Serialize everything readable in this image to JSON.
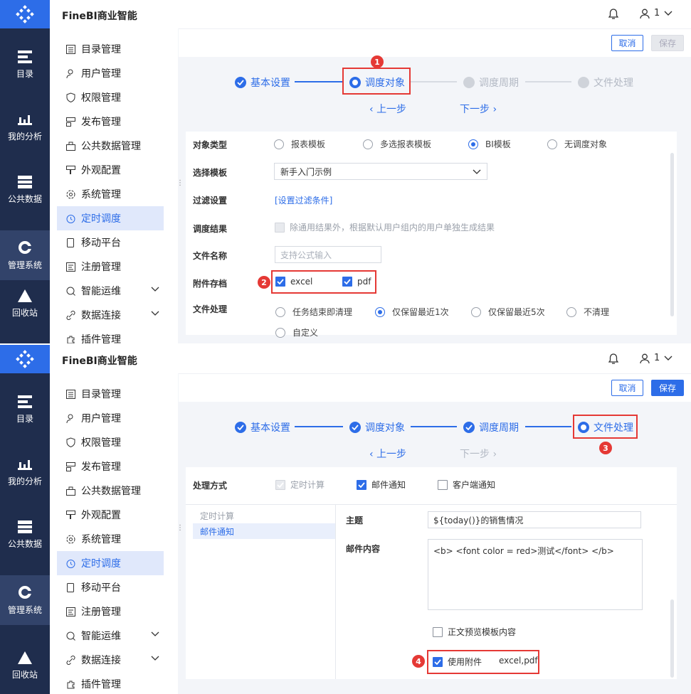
{
  "app": {
    "brand": "FineBI商业智能",
    "user_label": "1"
  },
  "rail": [
    {
      "label": "目录",
      "icon": "catalog-icon"
    },
    {
      "label": "我的分析",
      "icon": "analysis-icon"
    },
    {
      "label": "公共数据",
      "icon": "public-data-icon"
    },
    {
      "label": "管理系统",
      "icon": "gear-icon"
    },
    {
      "label": "回收站",
      "icon": "recycle-icon"
    }
  ],
  "subnav": [
    {
      "label": "目录管理"
    },
    {
      "label": "用户管理"
    },
    {
      "label": "权限管理"
    },
    {
      "label": "发布管理"
    },
    {
      "label": "公共数据管理"
    },
    {
      "label": "外观配置"
    },
    {
      "label": "系统管理"
    },
    {
      "label": "定时调度"
    },
    {
      "label": "移动平台"
    },
    {
      "label": "注册管理"
    },
    {
      "label": "智能运维"
    },
    {
      "label": "数据连接"
    },
    {
      "label": "插件管理"
    }
  ],
  "toolbar": {
    "cancel": "取消",
    "save": "保存"
  },
  "steps": [
    "基本设置",
    "调度对象",
    "调度周期",
    "文件处理"
  ],
  "nav": {
    "prev": "上一步",
    "next": "下一步"
  },
  "panel1": {
    "object_type": {
      "label": "对象类型",
      "options": [
        "报表模板",
        "多选报表模板",
        "BI模板",
        "无调度对象"
      ],
      "selected": "BI模板"
    },
    "template": {
      "label": "选择模板",
      "value": "新手入门示例"
    },
    "filter": {
      "label": "过滤设置",
      "link": "[设置过滤条件]"
    },
    "result": {
      "label": "调度结果",
      "checkbox": "除通用结果外，根据默认用户组内的用户单独生成结果"
    },
    "file_name": {
      "label": "文件名称",
      "placeholder": "支持公式输入"
    },
    "attachment": {
      "label": "附件存档",
      "options": [
        "excel",
        "pdf"
      ]
    },
    "file_proc": {
      "label": "文件处理",
      "options": [
        "任务结束即清理",
        "仅保留最近1次",
        "仅保留最近5次",
        "不清理",
        "自定义"
      ],
      "selected": "仅保留最近1次"
    }
  },
  "panel2": {
    "method": {
      "label": "处理方式",
      "options": [
        "定时计算",
        "邮件通知",
        "客户端通知"
      ]
    },
    "list": [
      "定时计算",
      "邮件通知"
    ],
    "subject": {
      "label": "主题",
      "value": "${today()}的销售情况"
    },
    "content": {
      "label": "邮件内容",
      "value": "<b> <font color = red>测试</font> </b>"
    },
    "preview": "正文预览模板内容",
    "use_attach": "使用附件",
    "attach_value": "excel,pdf"
  },
  "badges": [
    "1",
    "2",
    "3",
    "4"
  ],
  "colors": {
    "accent": "#2d6de8",
    "rail": "#1f2d4d",
    "highlight": "#e53935"
  }
}
